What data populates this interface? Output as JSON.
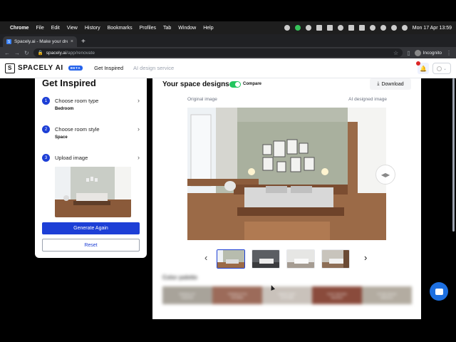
{
  "menubar": {
    "app": "Chrome",
    "items": [
      "File",
      "Edit",
      "View",
      "History",
      "Bookmarks",
      "Profiles",
      "Tab",
      "Window",
      "Help"
    ],
    "clock": "Mon 17 Apr  13:59"
  },
  "browser": {
    "tab_title": "Spacely.ai - Make your dream",
    "url_host": "spacely.ai",
    "url_path": "/app/renovate",
    "profile": "Incognito"
  },
  "header": {
    "logo": "SPACELY AI",
    "beta": "BETA",
    "nav": [
      "Get Inspired",
      "AI design service"
    ]
  },
  "left": {
    "title": "Get Inspired",
    "steps": [
      {
        "num": "1",
        "label": "Choose room type",
        "value": "Bedroom"
      },
      {
        "num": "2",
        "label": "Choose room style",
        "value": "Space"
      },
      {
        "num": "3",
        "label": "Upload image",
        "value": ""
      }
    ],
    "generate_label": "Generate Again",
    "reset_label": "Reset"
  },
  "main": {
    "title": "Your space designs",
    "compare_label": "Compare",
    "download_label": "Download",
    "original_caption": "Original image",
    "ai_caption": "AI designed image",
    "palette_title": "Color palette",
    "palette": [
      {
        "color": "#a8a39a",
        "name": "MINIMALIST",
        "hex": "#A8A39A"
      },
      {
        "color": "#9c6b5a",
        "name": "TERRACOTTA",
        "hex": "#9C6B5A"
      },
      {
        "color": "#c9c2bb",
        "name": "WARM GREY",
        "hex": "#C9C2BB"
      },
      {
        "color": "#8a4b3c",
        "name": "RUST BROWN",
        "hex": "#8A4B3C"
      },
      {
        "color": "#b3aca1",
        "name": "STONE BEIGE",
        "hex": "#B3ACA1"
      }
    ]
  },
  "colors": {
    "accent": "#1d3fd6",
    "toggle_on": "#22c55e"
  }
}
